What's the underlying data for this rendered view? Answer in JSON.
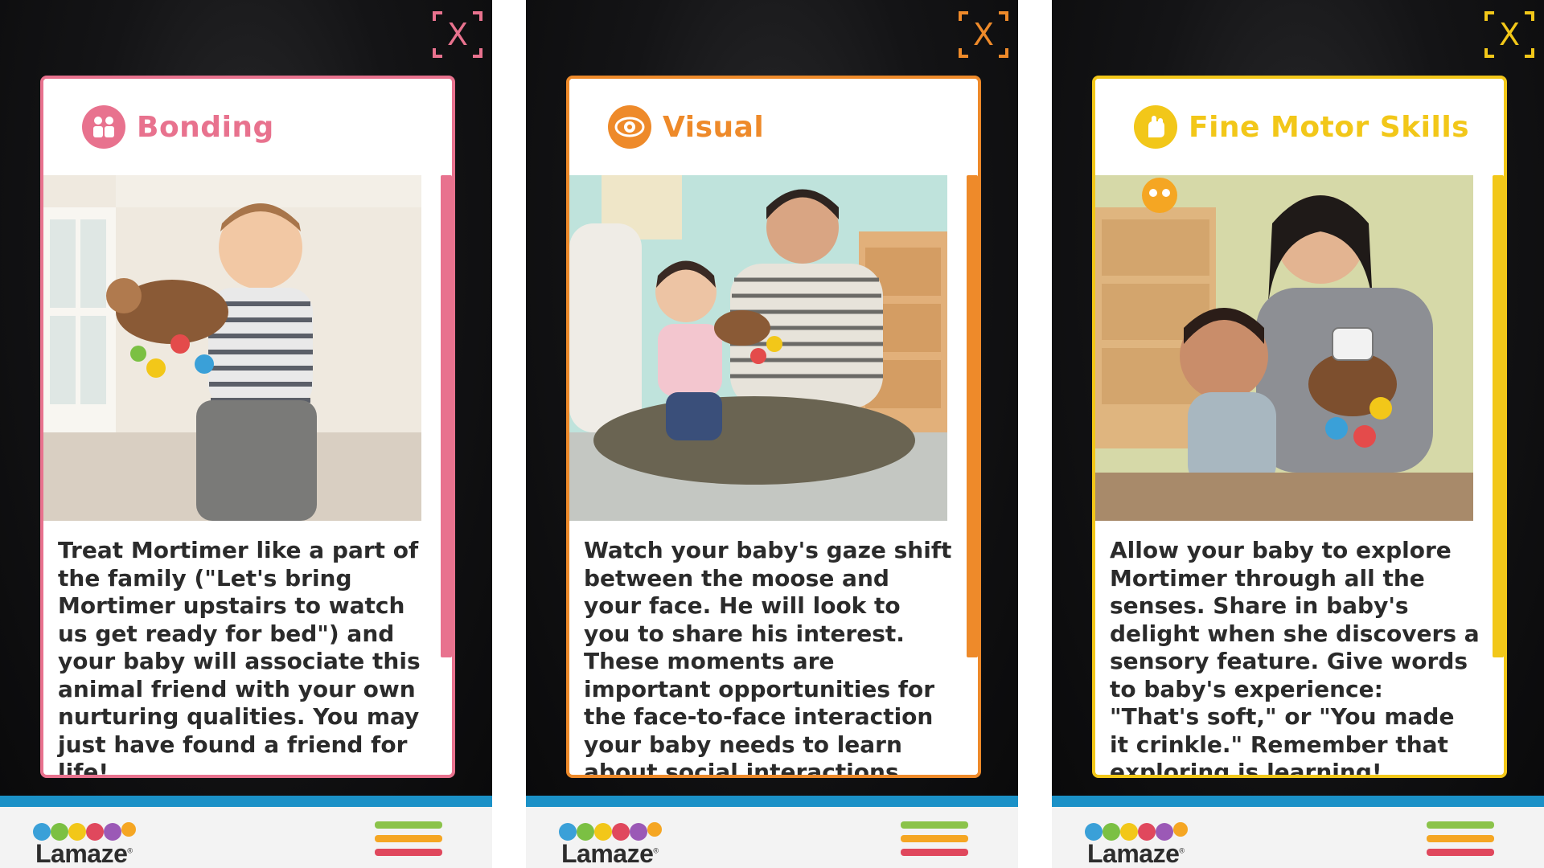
{
  "screens": [
    {
      "title": "Bonding",
      "icon": "bonding-people-icon",
      "accent": "#e8728e",
      "body": "Treat Mortimer like a part of the family (\"Let's bring Mortimer upstairs to watch us get ready for bed\") and your baby will associate this animal friend with your own nurturing qualities. You may just have found a friend for life!",
      "photo_alt": "toddler walking holding moose toy"
    },
    {
      "title": "Visual",
      "icon": "eye-icon",
      "accent": "#ee8a2a",
      "body": "Watch your baby's gaze shift between the moose and your face. He will look to you to share his interest. These moments are important opportunities for the face-to-face interaction your baby needs to learn about social interactions and his",
      "photo_alt": "father sitting with baby and moose toy"
    },
    {
      "title": "Fine Motor Skills",
      "icon": "hand-icon",
      "accent": "#f2c719",
      "body": "Allow your baby to explore Mortimer through all the senses. Share in baby's delight when she discovers a sensory feature. Give words to baby's experience: \"That's soft,\" or \"You made it crinkle.\" Remember that exploring is learning!",
      "photo_alt": "mother with baby holding moose toy"
    }
  ],
  "close_label": "X",
  "footer": {
    "brand": "Lamaze",
    "trademark": "®",
    "menu_colors": [
      "#8bc34a",
      "#f5a623",
      "#e0485d"
    ],
    "strip_color": "#1b91c7"
  }
}
